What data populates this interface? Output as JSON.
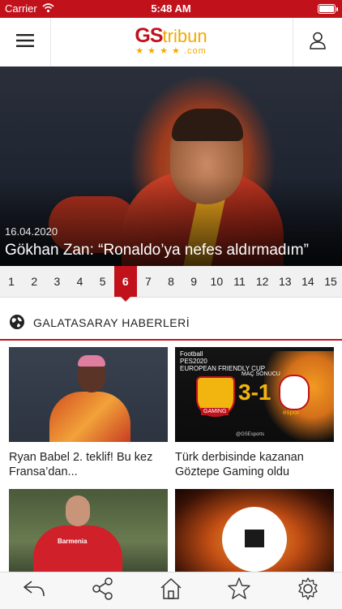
{
  "status_bar": {
    "carrier": "Carrier",
    "time": "5:48 AM"
  },
  "header": {
    "logo_main": "GS",
    "logo_tribun": "tribun",
    "logo_sub": "★ ★ ★ ★ .com"
  },
  "hero": {
    "date": "16.04.2020",
    "title": "Gökhan Zan: “Ronaldo’ya nefes aldırmadım”"
  },
  "pager": {
    "active": "6",
    "pages": [
      "1",
      "2",
      "3",
      "4",
      "5",
      "6",
      "7",
      "8",
      "9",
      "10",
      "11",
      "12",
      "13",
      "14",
      "15"
    ]
  },
  "section": {
    "title": "GALATASARAY HABERLERİ"
  },
  "articles": [
    {
      "caption": "Ryan Babel 2. teklif! Bu kez Fransa’dan..."
    },
    {
      "caption": "Türk derbisinde kazanan Göztepe Gaming oldu",
      "thumb_text": {
        "pes_title": "Football\nPES2020\nEUROPEAN FRIENDLY CUP",
        "mac_label": "MAÇ SONUCU",
        "score": "3-1",
        "team1_tag": "GAMING",
        "team2_tag": "espor",
        "handle": "@GSEsports"
      }
    },
    {
      "caption": "",
      "thumb_text": {
        "sponsor": "Barmenia"
      }
    },
    {
      "caption": ""
    }
  ],
  "tab_bar": {
    "icons": [
      "back-icon",
      "share-icon",
      "home-icon",
      "star-icon",
      "gear-icon"
    ]
  },
  "colors": {
    "brand_red": "#c1121c",
    "brand_gold": "#f2a900"
  }
}
